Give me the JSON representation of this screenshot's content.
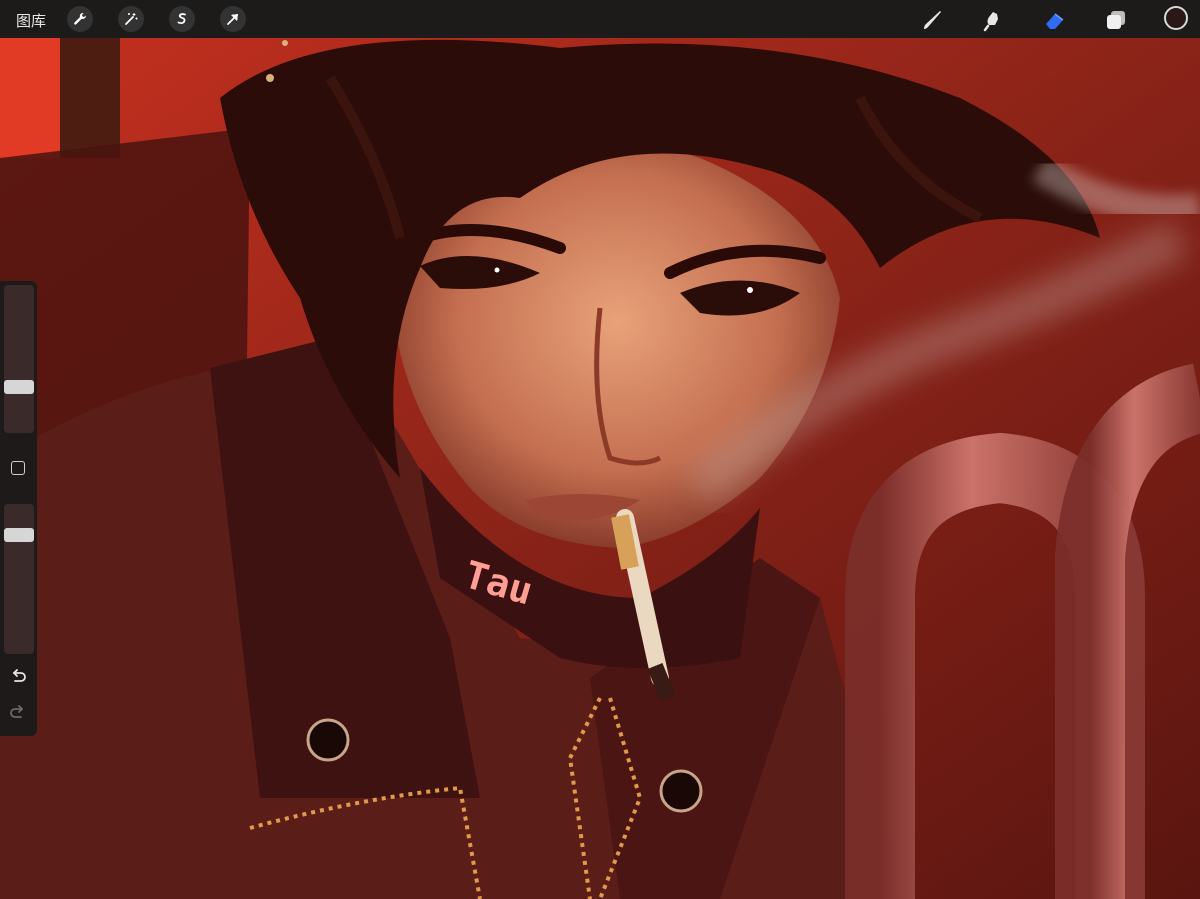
{
  "toolbar": {
    "gallery_label": "图库",
    "left_tools": [
      "wrench-icon",
      "magic-wand-icon",
      "selection-icon",
      "transform-arrow-icon"
    ],
    "right_tools": [
      "brush-icon",
      "smudge-icon",
      "eraser-icon",
      "layers-icon"
    ],
    "active_tool": "eraser-icon",
    "active_color": "#2a1716",
    "accent": "#2f6cf6"
  },
  "sidebar": {
    "size_slider": 0.72,
    "opacity_slider": 0.2,
    "modify_button": "square-button",
    "undo": "undo-icon",
    "redo": "redo-icon"
  },
  "canvas": {
    "collar_text": "Tau"
  }
}
